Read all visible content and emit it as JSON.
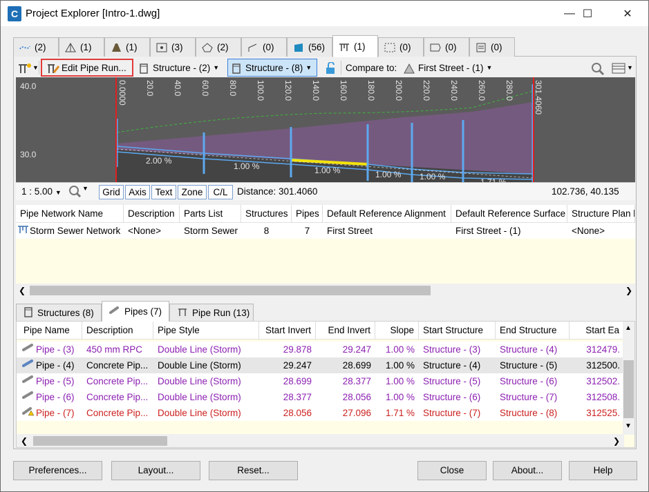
{
  "window": {
    "title": "Project Explorer [Intro-1.dwg]",
    "minimize": "—",
    "maximize": "☐",
    "close": "✕"
  },
  "top_tabs": [
    {
      "icon": "alignment-icon",
      "count": "(2)"
    },
    {
      "icon": "surface-icon",
      "count": "(1)"
    },
    {
      "icon": "corridor-icon",
      "count": "(1)"
    },
    {
      "icon": "point-group-icon",
      "count": "(3)"
    },
    {
      "icon": "parcel-icon",
      "count": "(2)"
    },
    {
      "icon": "feature-line-icon",
      "count": "(0)"
    },
    {
      "icon": "structure-icon",
      "count": "(56)"
    },
    {
      "icon": "pipe-network-icon",
      "count": "(1)"
    },
    {
      "icon": "profile-view-icon",
      "count": "(0)"
    },
    {
      "icon": "label-icon",
      "count": "(0)"
    },
    {
      "icon": "sheet-icon",
      "count": "(0)"
    }
  ],
  "toolbar": {
    "edit_pipe_run": "Edit Pipe Run...",
    "structure_2": "Structure - (2)",
    "structure_8": "Structure - (8)",
    "compare_to_label": "Compare to:",
    "compare_target": "First Street - (1)"
  },
  "profile": {
    "y_labels": [
      "40.0",
      "30.0"
    ],
    "stations": [
      "0.0000",
      "20.0",
      "40.0",
      "60.0",
      "80.0",
      "100.0",
      "120.0",
      "140.0",
      "160.0",
      "180.0",
      "200.0",
      "220.0",
      "240.0",
      "260.0",
      "280.0",
      "301.4060"
    ],
    "slopes": [
      "2.00 %",
      "1.00 %",
      "1.00 %",
      "1.00 %",
      "1.00 %",
      "1.71 %"
    ]
  },
  "chart_controls": {
    "scale": "1 : 5.00",
    "buttons": [
      "Grid",
      "Axis",
      "Text",
      "Zone",
      "C/L"
    ],
    "distance": "Distance: 301.4060",
    "coords": "102.736, 40.135"
  },
  "network_grid": {
    "headers": [
      "Pipe Network Name",
      "Description",
      "Parts List",
      "Structures",
      "Pipes",
      "Default Reference Alignment",
      "Default Reference Surface",
      "Structure Plan l"
    ],
    "row": [
      "Storm Sewer Network",
      "<None>",
      "Storm Sewer",
      "8",
      "7",
      "First Street",
      "First Street - (1)",
      "<None>"
    ]
  },
  "bottom_tabs": [
    {
      "label": "Structures (8)"
    },
    {
      "label": "Pipes (7)"
    },
    {
      "label": "Pipe Run (13)"
    }
  ],
  "pipes_grid": {
    "headers": [
      "Pipe Name",
      "Description",
      "Pipe Style",
      "Start Invert",
      "End Invert",
      "Slope",
      "Start Structure",
      "End Structure",
      "Start Ea"
    ],
    "rows": [
      [
        "Pipe - (3)",
        "450 mm RPC",
        "Double Line (Storm)",
        "29.878",
        "29.247",
        "1.00 %",
        "Structure - (3)",
        "Structure - (4)",
        "312479."
      ],
      [
        "Pipe - (4)",
        "Concrete Pip...",
        "Double Line (Storm)",
        "29.247",
        "28.699",
        "1.00 %",
        "Structure - (4)",
        "Structure - (5)",
        "312500."
      ],
      [
        "Pipe - (5)",
        "Concrete Pip...",
        "Double Line (Storm)",
        "28.699",
        "28.377",
        "1.00 %",
        "Structure - (5)",
        "Structure - (6)",
        "312502."
      ],
      [
        "Pipe - (6)",
        "Concrete Pip...",
        "Double Line (Storm)",
        "28.377",
        "28.056",
        "1.00 %",
        "Structure - (6)",
        "Structure - (7)",
        "312508."
      ],
      [
        "Pipe - (7)",
        "Concrete Pip...",
        "Double Line (Storm)",
        "28.056",
        "27.096",
        "1.71 %",
        "Structure - (7)",
        "Structure - (8)",
        "312525."
      ]
    ]
  },
  "footer": {
    "preferences": "Preferences...",
    "layout": "Layout...",
    "reset": "Reset...",
    "close": "Close",
    "about": "About...",
    "help": "Help"
  },
  "colors": {
    "accent": "#3c7fd8",
    "highlight_red": "#e03a3a",
    "purple_text": "#8b1fb1",
    "red_text": "#cc1f1f",
    "profile_bg": "#5b5b5b"
  }
}
